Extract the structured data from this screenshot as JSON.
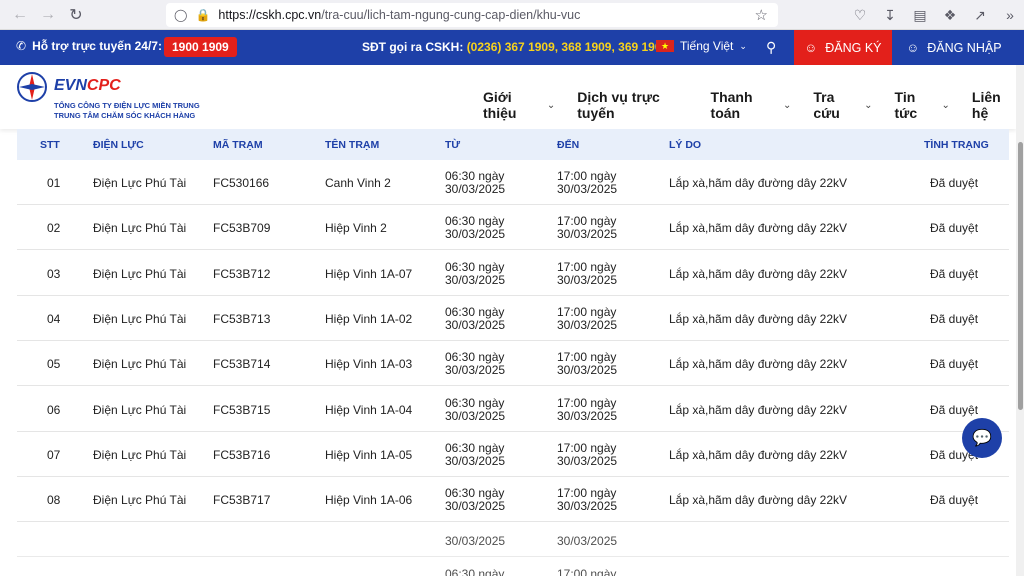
{
  "browser": {
    "url_host": "https://cskh.cpc.vn",
    "url_path": "/tra-cuu/lich-tam-ngung-cung-cap-dien/khu-vuc"
  },
  "topbar": {
    "hotline_label": "Hỗ trợ trực tuyến 24/7:",
    "hotline_number": "1900 1909",
    "cskh_label": "SĐT gọi ra CSKH:",
    "cskh_numbers": "(0236) 367 1909, 368 1909, 369 1909",
    "language": "Tiếng Việt",
    "register": "ĐĂNG KÝ",
    "login": "ĐĂNG NHẬP"
  },
  "header": {
    "logo_evn": "EVN",
    "logo_cpc": "CPC",
    "logo_sub1": "TỔNG CÔNG TY ĐIỆN LỰC MIỀN TRUNG",
    "logo_sub2": "TRUNG TÂM CHĂM SÓC KHÁCH HÀNG",
    "menu": [
      "Giới thiệu",
      "Dịch vụ trực tuyến",
      "Thanh toán",
      "Tra cứu",
      "Tin tức",
      "Liên hệ"
    ]
  },
  "table": {
    "headers": [
      "STT",
      "ĐIỆN LỰC",
      "MÃ TRẠM",
      "TÊN TRẠM",
      "TỪ",
      "ĐẾN",
      "LÝ DO",
      "TÌNH TRẠNG"
    ],
    "rows": [
      {
        "stt": "01",
        "dien_luc": "Điện Lực Phú Tài",
        "ma_tram": "FC530166",
        "ten_tram": "Canh Vinh 2",
        "tu_time": "06:30 ngày",
        "tu_date": "30/03/2025",
        "den_time": "17:00 ngày",
        "den_date": "30/03/2025",
        "ly_do": "Lắp xà,hãm dây đường dây 22kV",
        "tinh_trang": "Đã duyệt"
      },
      {
        "stt": "02",
        "dien_luc": "Điện Lực Phú Tài",
        "ma_tram": "FC53B709",
        "ten_tram": "Hiệp Vinh 2",
        "tu_time": "06:30 ngày",
        "tu_date": "30/03/2025",
        "den_time": "17:00 ngày",
        "den_date": "30/03/2025",
        "ly_do": "Lắp xà,hãm dây đường dây 22kV",
        "tinh_trang": "Đã duyệt"
      },
      {
        "stt": "03",
        "dien_luc": "Điện Lực Phú Tài",
        "ma_tram": "FC53B712",
        "ten_tram": "Hiệp Vinh 1A-07",
        "tu_time": "06:30 ngày",
        "tu_date": "30/03/2025",
        "den_time": "17:00 ngày",
        "den_date": "30/03/2025",
        "ly_do": "Lắp xà,hãm dây đường dây 22kV",
        "tinh_trang": "Đã duyệt"
      },
      {
        "stt": "04",
        "dien_luc": "Điện Lực Phú Tài",
        "ma_tram": "FC53B713",
        "ten_tram": "Hiệp Vinh 1A-02",
        "tu_time": "06:30 ngày",
        "tu_date": "30/03/2025",
        "den_time": "17:00 ngày",
        "den_date": "30/03/2025",
        "ly_do": "Lắp xà,hãm dây đường dây 22kV",
        "tinh_trang": "Đã duyệt"
      },
      {
        "stt": "05",
        "dien_luc": "Điện Lực Phú Tài",
        "ma_tram": "FC53B714",
        "ten_tram": "Hiệp Vinh 1A-03",
        "tu_time": "06:30 ngày",
        "tu_date": "30/03/2025",
        "den_time": "17:00 ngày",
        "den_date": "30/03/2025",
        "ly_do": "Lắp xà,hãm dây đường dây 22kV",
        "tinh_trang": "Đã duyệt"
      },
      {
        "stt": "06",
        "dien_luc": "Điện Lực Phú Tài",
        "ma_tram": "FC53B715",
        "ten_tram": "Hiệp Vinh 1A-04",
        "tu_time": "06:30 ngày",
        "tu_date": "30/03/2025",
        "den_time": "17:00 ngày",
        "den_date": "30/03/2025",
        "ly_do": "Lắp xà,hãm dây đường dây 22kV",
        "tinh_trang": "Đã duyệt"
      },
      {
        "stt": "07",
        "dien_luc": "Điện Lực Phú Tài",
        "ma_tram": "FC53B716",
        "ten_tram": "Hiệp Vinh 1A-05",
        "tu_time": "06:30 ngày",
        "tu_date": "30/03/2025",
        "den_time": "17:00 ngày",
        "den_date": "30/03/2025",
        "ly_do": "Lắp xà,hãm dây đường dây 22kV",
        "tinh_trang": "Đã duyệt"
      },
      {
        "stt": "08",
        "dien_luc": "Điện Lực Phú Tài",
        "ma_tram": "FC53B717",
        "ten_tram": "Hiệp Vinh 1A-06",
        "tu_time": "06:30 ngày",
        "tu_date": "30/03/2025",
        "den_time": "17:00 ngày",
        "den_date": "30/03/2025",
        "ly_do": "Lắp xà,hãm dây đường dây 22kV",
        "tinh_trang": "Đã duyệt"
      }
    ],
    "partial_date": "30/03/2025",
    "partial_from": "06:30 ngày",
    "partial_to": "17:00 ngày"
  },
  "colors": {
    "primary": "#1e40a8",
    "accent_red": "#e3201b",
    "highlight_yellow": "#f7d21c",
    "header_bg": "#e8effa"
  }
}
